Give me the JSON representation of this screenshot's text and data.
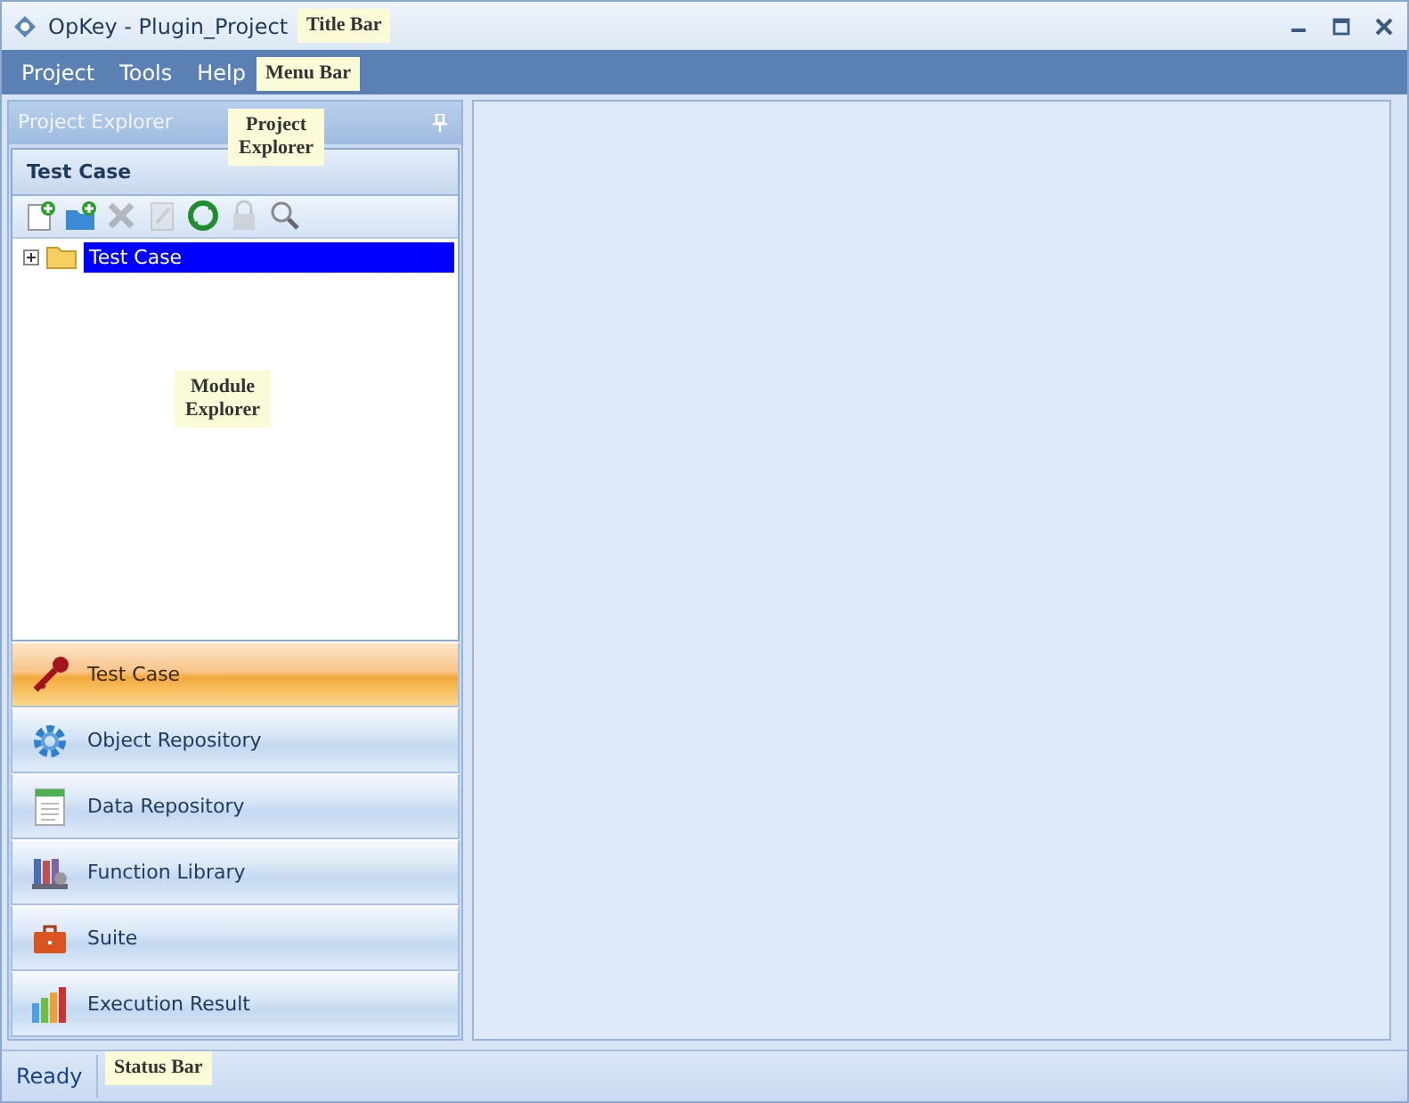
{
  "window": {
    "title": "OpKey - Plugin_Project"
  },
  "menu_bar": [
    "Project",
    "Tools",
    "Help"
  ],
  "project_explorer": {
    "title": "Project Explorer",
    "section_title": "Test Case",
    "toolbar": [
      {
        "kind": "new-file",
        "disabled": false
      },
      {
        "kind": "new-folder",
        "disabled": false
      },
      {
        "kind": "delete",
        "disabled": true
      },
      {
        "kind": "edit",
        "disabled": true
      },
      {
        "kind": "refresh",
        "disabled": false
      },
      {
        "kind": "lock",
        "disabled": true
      },
      {
        "kind": "search",
        "disabled": false
      }
    ],
    "tree": [
      {
        "label": "Test Case",
        "selected": true,
        "expanded": false
      }
    ],
    "nav": [
      {
        "label": "Test Case",
        "kind": "key",
        "selected": true
      },
      {
        "label": "Object Repository",
        "kind": "gear",
        "selected": false
      },
      {
        "label": "Data Repository",
        "kind": "sheet",
        "selected": false
      },
      {
        "label": "Function Library",
        "kind": "books",
        "selected": false
      },
      {
        "label": "Suite",
        "kind": "briefcase",
        "selected": false
      },
      {
        "label": "Execution Result",
        "kind": "bars",
        "selected": false
      }
    ]
  },
  "status_bar": {
    "text": "Ready"
  },
  "callouts": [
    "Title Bar",
    "Menu Bar",
    "Project Explorer",
    "Module Explorer",
    "Status Bar"
  ]
}
